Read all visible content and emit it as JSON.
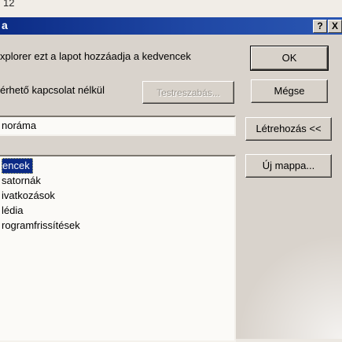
{
  "top_number": "12",
  "window": {
    "title": "a",
    "help_label": "?",
    "close_label": "X"
  },
  "message": "xplorer ezt a lapot hozzáadja a kedvencek",
  "offline_checkbox_label": "érhető kapcsolat nélkül",
  "buttons": {
    "ok": "OK",
    "cancel": "Mégse",
    "customize": "Testreszabás...",
    "create_in": "Létrehozás <<",
    "new_folder": "Új mappa..."
  },
  "name_field_value": "noráma",
  "folders": {
    "selected": "encek",
    "items": [
      "satornák",
      "ivatkozások",
      "lédia",
      "rogramfrissítések"
    ]
  },
  "colors": {
    "titlebar": "#0c2c86",
    "selection": "#0b2a85",
    "dialog_bg": "#d9d3cc"
  }
}
